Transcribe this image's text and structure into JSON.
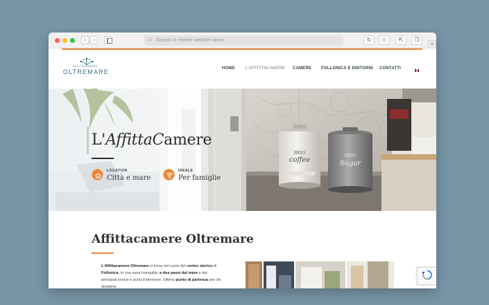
{
  "browser": {
    "address_placeholder": "Search or eneter website name",
    "icons": [
      "back-icon",
      "forward-icon",
      "sidebar-icon",
      "search-icon",
      "reload-icon",
      "bookmark-icon",
      "share-icon",
      "tabs-icon",
      "new-tab-icon"
    ]
  },
  "site": {
    "logo": {
      "tagline": "AFFITTACAMERE",
      "name": "OLTREMARE"
    },
    "menu": [
      {
        "label": "HOME"
      },
      {
        "label": "L'AFFITTACAMERE"
      },
      {
        "label": "CAMERE"
      },
      {
        "label": "FOLLONICA E DINTORNI"
      },
      {
        "label": "CONTATTI"
      }
    ],
    "language_flag": "uk-flag-icon"
  },
  "hero": {
    "title_part1": "L'",
    "title_italic1": "Affitta",
    "title_italic2": "C",
    "title_part2": "amere",
    "features": [
      {
        "label": "LOCATION",
        "value": "Città e mare",
        "icon": "location-icon"
      },
      {
        "label": "IDEALE",
        "value": "Per famiglie",
        "icon": "family-icon"
      }
    ]
  },
  "intro": {
    "title": "Affittacamere Oltremare",
    "text": {
      "b1": "L'Affittacamere Oltremare",
      "t1": " si trova nel cuore del ",
      "b2": "centro storico",
      "t2": " di ",
      "b3": "Follonica",
      "t3": ", in una zona tranquilla, ",
      "b4": "a due passi dal mare",
      "t4": " e dai principali servizi e punti d'interesse. Ottimo ",
      "b5": "punto di partenza",
      "t5": " per chi desidera"
    }
  },
  "colors": {
    "accent": "#e88538",
    "brand": "#3a6e84",
    "background": "#7896a8"
  }
}
